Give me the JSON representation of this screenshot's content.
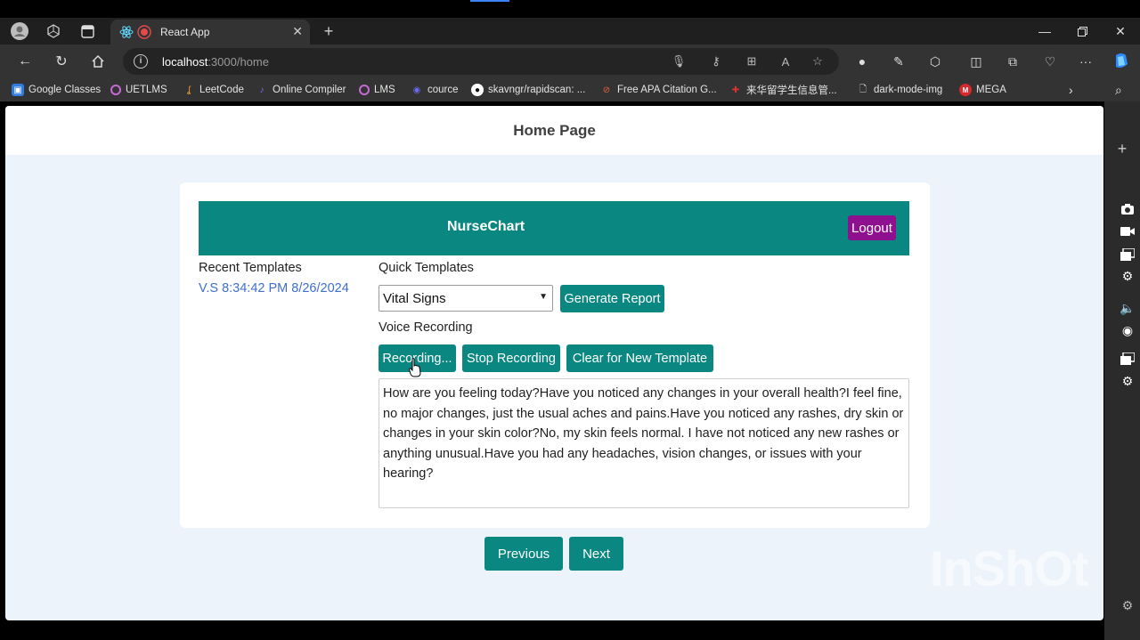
{
  "browser": {
    "tab_title": "React App",
    "url_host": "localhost",
    "url_path": ":3000/home",
    "bookmarks": [
      {
        "label": "Google Classes"
      },
      {
        "label": "UETLMS"
      },
      {
        "label": "LeetCode"
      },
      {
        "label": "Online Compiler"
      },
      {
        "label": "LMS"
      },
      {
        "label": "cource"
      },
      {
        "label": "skavngr/rapidscan: ..."
      },
      {
        "label": "Free APA Citation G..."
      },
      {
        "label": "来华留学生信息管..."
      },
      {
        "label": "dark-mode-img"
      },
      {
        "label": "MEGA"
      }
    ]
  },
  "page": {
    "header_title": "Home Page",
    "brand": "NurseChart",
    "logout_label": "Logout",
    "recent_templates_label": "Recent Templates",
    "recent_templates": [
      "V.S 8:34:42 PM 8/26/2024"
    ],
    "quick_templates_label": "Quick Templates",
    "template_select_value": "Vital Signs",
    "generate_report_label": "Generate Report",
    "voice_recording_label": "Voice Recording",
    "recording_label": "Recording...",
    "stop_recording_label": "Stop Recording",
    "clear_label": "Clear for New Template",
    "transcript": "How are you feeling today?Have you noticed any changes in your overall health?I feel fine, no major changes, just the usual aches and pains.Have you noticed any rashes, dry skin or changes in your skin color?No, my skin feels normal. I have not noticed any new rashes or anything unusual.Have you had any headaches, vision changes, or issues with your hearing?",
    "previous_label": "Previous",
    "next_label": "Next"
  },
  "watermark": "InShOt",
  "colors": {
    "primary": "#0a8781",
    "logout": "#8e108f",
    "link": "#3f6fcf",
    "page_bg": "#edf3fb"
  }
}
